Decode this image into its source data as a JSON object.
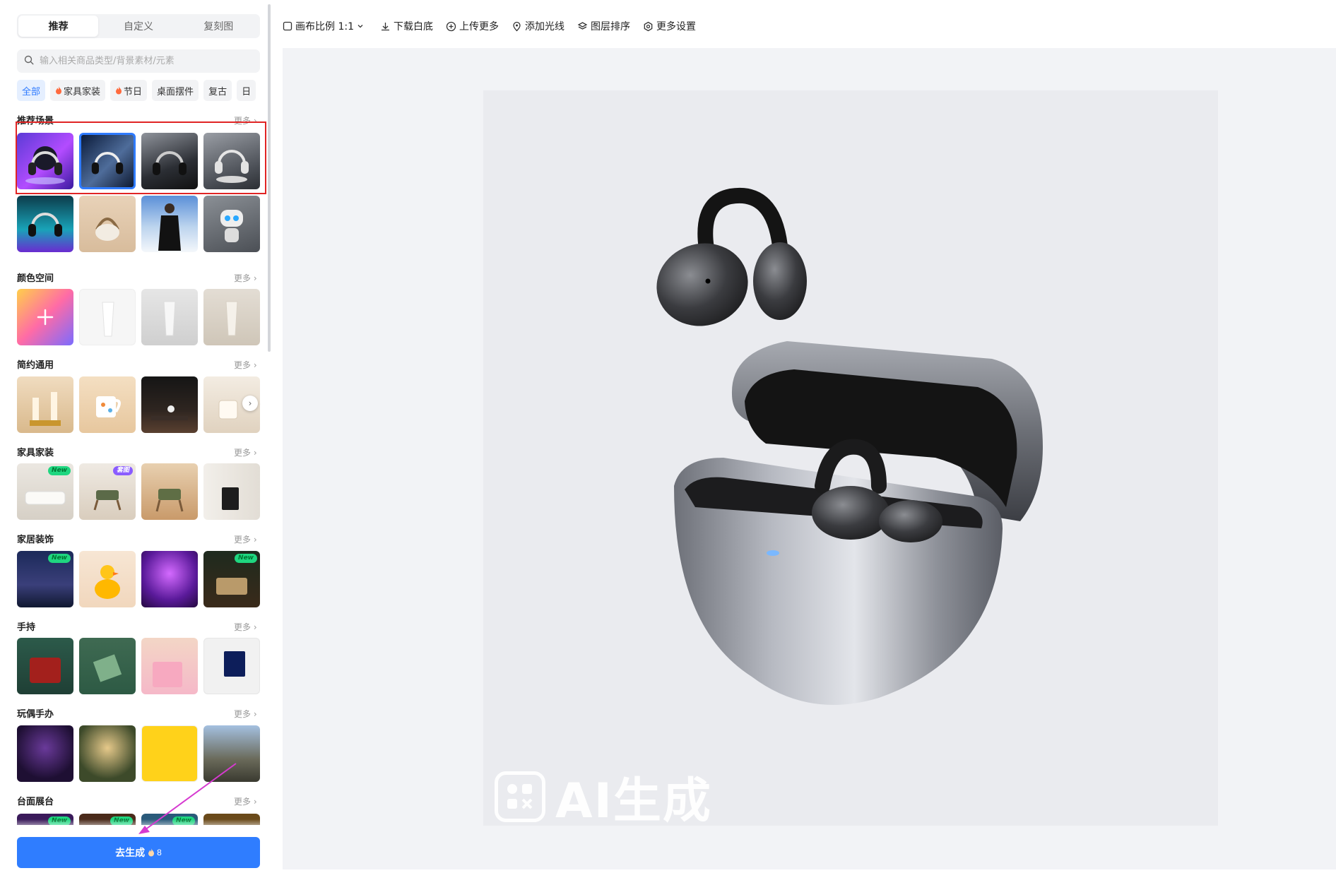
{
  "sidebar": {
    "tabs": [
      {
        "label": "推荐",
        "active": true
      },
      {
        "label": "自定义",
        "active": false
      },
      {
        "label": "复刻图",
        "active": false
      }
    ],
    "search_placeholder": "输入相关商品类型/背景素材/元素",
    "chips": [
      {
        "label": "全部",
        "active": true,
        "hot": false
      },
      {
        "label": "家具家装",
        "active": false,
        "hot": true
      },
      {
        "label": "节日",
        "active": false,
        "hot": true
      },
      {
        "label": "桌面摆件",
        "active": false,
        "hot": false
      },
      {
        "label": "复古",
        "active": false,
        "hot": false
      },
      {
        "label": "日",
        "active": false,
        "hot": false
      }
    ],
    "more_label": "更多",
    "sections": [
      {
        "title": "推荐场景",
        "thumbs": [
          "headphone-purple-neon",
          "headphone-dark-blue",
          "headphone-dark",
          "headphone-silver-stage",
          "headphone-teal-neon",
          "bag-beige",
          "man-black-coat-snow",
          "robot-toy"
        ]
      },
      {
        "title": "颜色空间",
        "thumbs": [
          "add-color",
          "tube-white",
          "tube-grey",
          "tube-beige"
        ]
      },
      {
        "title": "简约通用",
        "thumbs": [
          "candles-gold",
          "mug-floral",
          "dark-table-figure",
          "candle-cream"
        ]
      },
      {
        "title": "家具家装",
        "thumbs": [
          "sofa-white",
          "armchair-room",
          "armchair-wood",
          "bin-room"
        ],
        "badges": [
          "New",
          "套图",
          "",
          ""
        ]
      },
      {
        "title": "家居装饰",
        "thumbs": [
          "night-forest",
          "duck-yellow",
          "halloween-purple",
          "jewelry-box"
        ],
        "badges": [
          "New",
          "",
          "",
          "New"
        ]
      },
      {
        "title": "手持",
        "thumbs": [
          "red-bag-hand",
          "green-gift-hands",
          "pink-bag",
          "blue-box-hand"
        ]
      },
      {
        "title": "玩偶手办",
        "thumbs": [
          "dark-doll",
          "forest-figure",
          "pop-figures",
          "helmet-figure-road"
        ]
      },
      {
        "title": "台面展台",
        "thumbs": [
          "stage-1",
          "stage-2",
          "stage-3",
          "stage-4"
        ],
        "badges": [
          "New",
          "New",
          "New",
          ""
        ]
      }
    ],
    "generate_label": "去生成",
    "generate_cost": "8"
  },
  "toolbar": {
    "items": [
      {
        "label": "画布比例 1:1",
        "icon": "square-icon"
      },
      {
        "label": "下载白底",
        "icon": "download-icon"
      },
      {
        "label": "上传更多",
        "icon": "plus-circle-icon"
      },
      {
        "label": "添加光线",
        "icon": "light-icon"
      },
      {
        "label": "图层排序",
        "icon": "layers-icon"
      },
      {
        "label": "更多设置",
        "icon": "settings-icon"
      }
    ]
  },
  "canvas": {
    "watermark": "AI生成",
    "product": "open-ear earbuds with silver charging case"
  },
  "colors": {
    "accent": "#2f7dff",
    "annotation_red": "#e02424",
    "annotation_arrow": "#d63ad0"
  }
}
